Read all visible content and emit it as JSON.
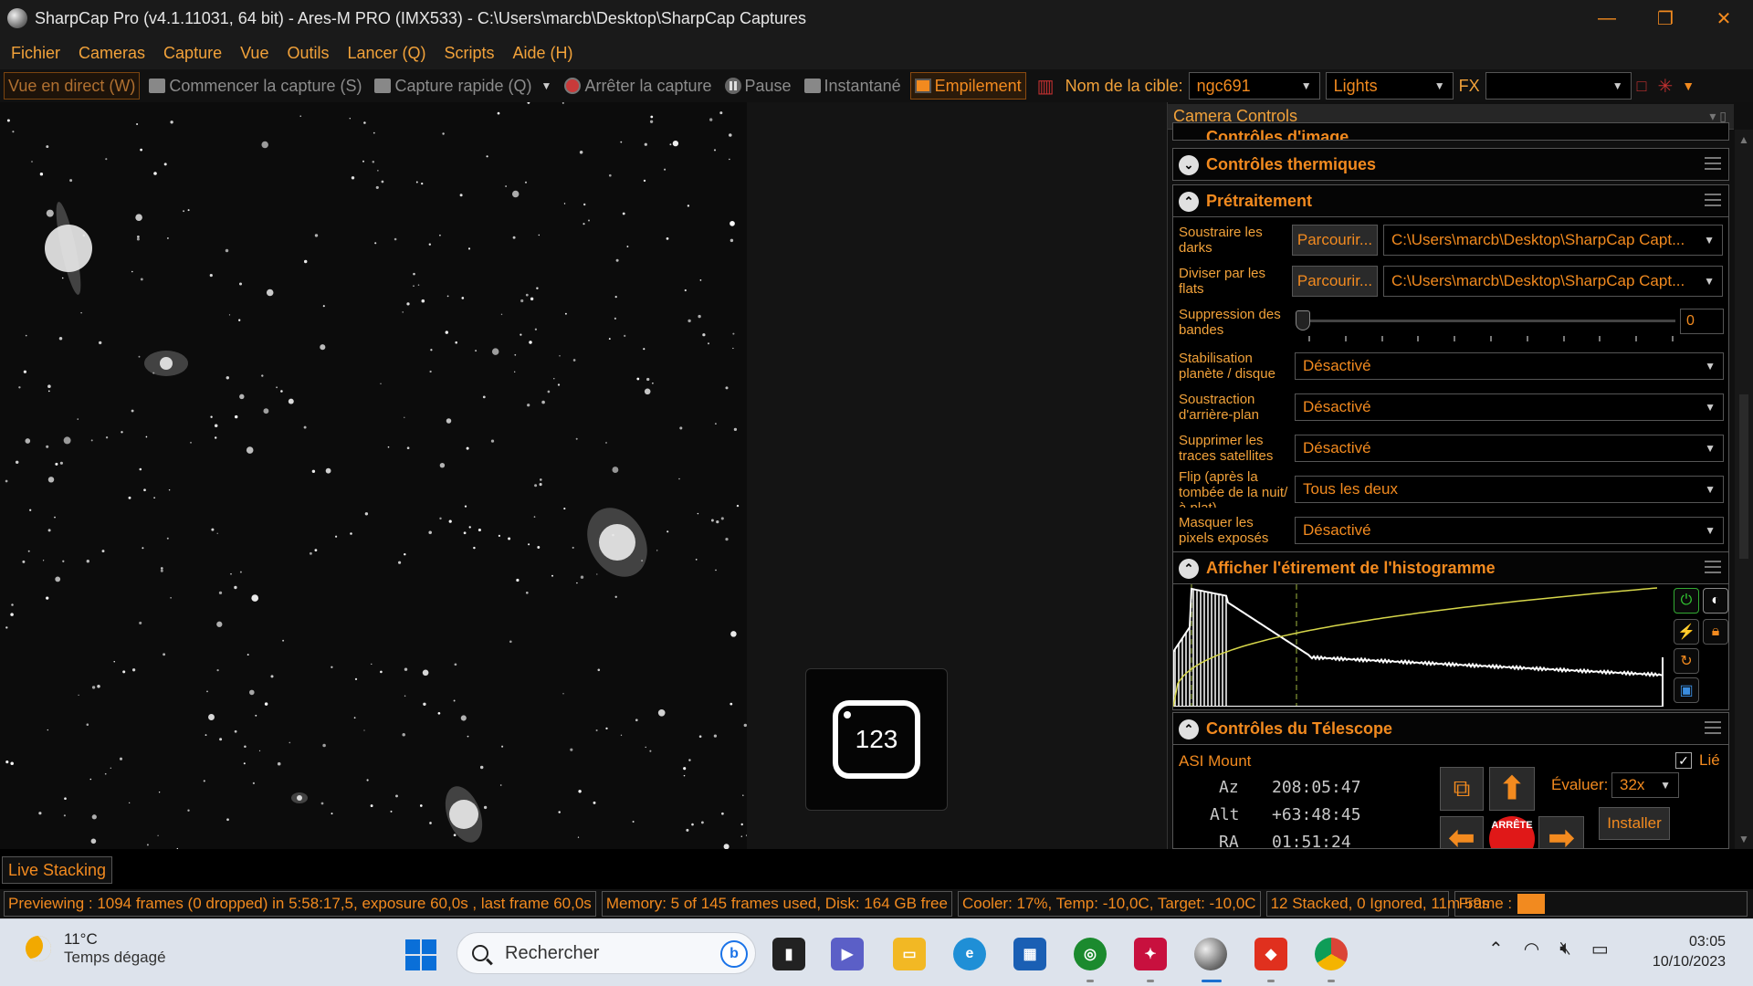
{
  "window": {
    "title": "SharpCap Pro (v4.1.11031, 64 bit) - Ares-M PRO (IMX533) - C:\\Users\\marcb\\Desktop\\SharpCap Captures",
    "controls": [
      "—",
      "❐",
      "✕"
    ]
  },
  "menu": [
    "Fichier",
    "Cameras",
    "Capture",
    "Vue",
    "Outils",
    "Lancer (Q)",
    "Scripts",
    "Aide (H)"
  ],
  "toolbar": {
    "live_view": "Vue en direct (W)",
    "start_capture": "Commencer la capture (S)",
    "quick_capture": "Capture rapide (Q)",
    "stop_capture": "Arrêter la capture",
    "pause": "Pause",
    "snapshot": "Instantané",
    "stacking": "Empilement",
    "target_label": "Nom de la cible:",
    "target_value": "ngc691",
    "frame_type": "Lights",
    "fx_label": "FX",
    "fx_value": ""
  },
  "overlay_tile": {
    "text": "123"
  },
  "panel": {
    "title": "Camera Controls",
    "partial_section": "Contrôles d'image",
    "thermal": "Contrôles thermiques",
    "preprocessing": {
      "title": "Prétraitement",
      "darks_label": "Soustraire les darks",
      "flats_label": "Diviser par les flats",
      "browse": "Parcourir...",
      "darks_path": "C:\\Users\\marcb\\Desktop\\SharpCap Capt...",
      "flats_path": "C:\\Users\\marcb\\Desktop\\SharpCap Capt...",
      "banding_label": "Suppression des bandes",
      "banding_value": "0",
      "banding_level": 0,
      "stabilization_label": "Stabilisation planète / disque",
      "stabilization_value": "Désactivé",
      "bg_sub_label": "Soustraction d'arrière-plan",
      "bg_sub_value": "Désactivé",
      "sat_label": "Supprimer les traces satellites",
      "sat_value": "Désactivé",
      "flip_label": "Flip (après la tombée de la nuit/à plat)",
      "flip_value": "Tous les deux",
      "mask_label": "Masquer les pixels exposés",
      "mask_value": "Désactivé"
    },
    "histogram": {
      "title": "Afficher l'étirement de l'histogramme"
    },
    "telescope": {
      "title": "Contrôles du Télescope",
      "mount": "ASI Mount",
      "linked_label": "Lié",
      "linked": true,
      "az_label": "Az",
      "az_value": "208:05:47",
      "alt_label": "Alt",
      "alt_value": "+63:48:45",
      "ra_label": "RA",
      "ra_value": "01:51:24",
      "rate_label": "Évaluer:",
      "rate_value": "32x",
      "install": "Installer",
      "stop": "ARRÊTE"
    }
  },
  "bottom_tab": "Live Stacking",
  "status": {
    "previewing": "Previewing : 1094 frames (0 dropped) in 5:58:17,5, exposure 60,0s , last frame 60,0s",
    "memory": "Memory: 5 of 145 frames used, Disk: 164 GB free",
    "cooler": "Cooler: 17%, Temp: -10,0C, Target: -10,0C",
    "stacked": "12 Stacked, 0 Ignored, 11m 59s",
    "frame_label": "Frame :"
  },
  "taskbar": {
    "weather_temp": "11°C",
    "weather_cond": "Temps dégagé",
    "search_placeholder": "Rechercher",
    "time": "03:05",
    "date": "10/10/2023"
  },
  "colors": {
    "accent": "#f28a1f",
    "label": "#f2a23a",
    "background": "#000000",
    "taskbar": "#dde3ec"
  }
}
